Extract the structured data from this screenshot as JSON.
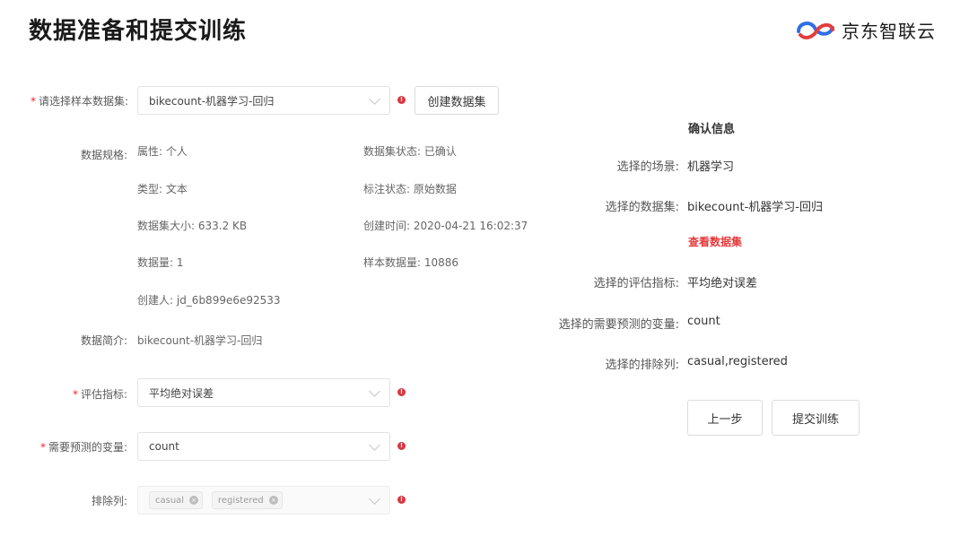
{
  "page": {
    "title": "数据准备和提交训练"
  },
  "brand": {
    "name": "京东智联云"
  },
  "form": {
    "dataset": {
      "label": "请选择样本数据集:",
      "value": "bikecount-机器学习-回归",
      "create_button": "创建数据集"
    },
    "spec": {
      "label": "数据规格:",
      "items": [
        {
          "text": "属性:  个人"
        },
        {
          "text": "数据集状态:  已确认"
        },
        {
          "text": "类型:  文本"
        },
        {
          "text": "标注状态:  原始数据"
        },
        {
          "text": "数据集大小:  633.2 KB"
        },
        {
          "text": "创建时间:  2020-04-21 16:02:37"
        },
        {
          "text": "数据量:  1"
        },
        {
          "text": "样本数据量:  10886"
        },
        {
          "text": "创建人:  jd_6b899e6e92533"
        }
      ]
    },
    "intro": {
      "label": "数据简介:",
      "value": "bikecount-机器学习-回归"
    },
    "metric": {
      "label": "评估指标:",
      "value": "平均绝对误差"
    },
    "target": {
      "label": "需要预测的变量:",
      "value": "count"
    },
    "exclude": {
      "label": "排除列:",
      "tags": [
        "casual",
        "registered"
      ]
    }
  },
  "confirm": {
    "title": "确认信息",
    "rows": [
      {
        "label": "选择的场景:",
        "value": "机器学习"
      },
      {
        "label": "选择的数据集:",
        "value": "bikecount-机器学习-回归"
      },
      {
        "label": "选择的评估指标:",
        "value": "平均绝对误差"
      },
      {
        "label": "选择的需要预测的变量:",
        "value": "count"
      },
      {
        "label": "选择的排除列:",
        "value": "casual,registered"
      }
    ],
    "view_dataset_link": "查看数据集",
    "prev_button": "上一步",
    "submit_button": "提交训练"
  },
  "icons": {
    "brand_logo": "jd-cloud-logo-icon",
    "error": "error-icon",
    "dropdown": "chevron-down-icon",
    "tag_close": "close-icon"
  },
  "colors": {
    "required": "#f5222d",
    "error_icon": "#d9363e",
    "link": "#e4393c",
    "logo_blue": "#2f6fe6",
    "logo_red": "#e33d3d"
  }
}
